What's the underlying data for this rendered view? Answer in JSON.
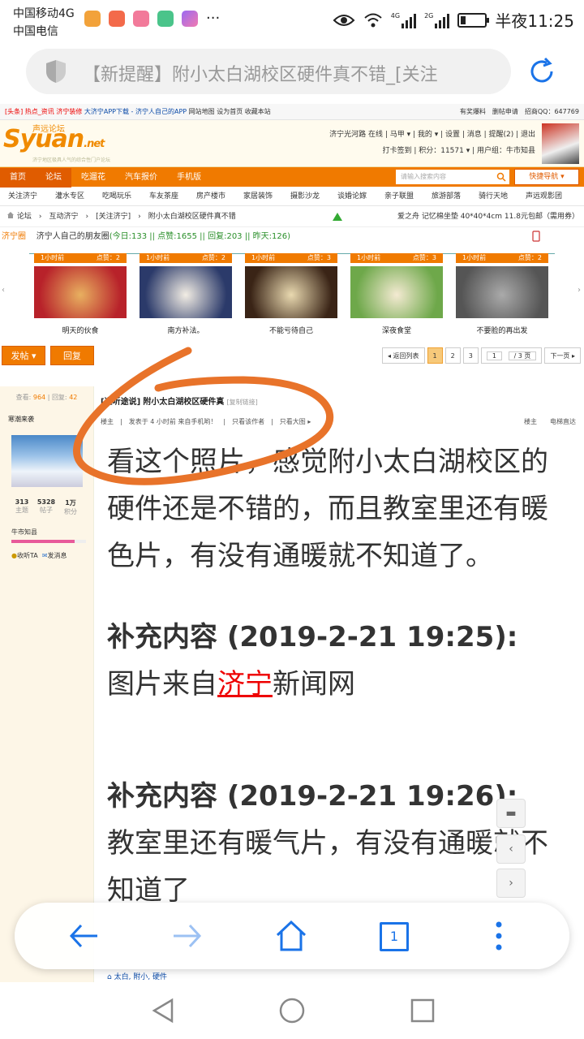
{
  "status": {
    "carrier1": "中国移动4G",
    "carrier2": "中国电信",
    "net1": "4G",
    "net2": "2G",
    "time": "半夜11:25"
  },
  "browser": {
    "url_title": "【新提醒】附小太白湖校区硬件真不错_[关注"
  },
  "site": {
    "topnav": {
      "hot": "[头条]",
      "hot_link": "热点_资讯",
      "jn": "济宁装修",
      "app": "大济宁APP下载 - 济宁人自己的APP",
      "map": "网站地图",
      "home": "设为首页",
      "fav": "收藏本站",
      "right": "有奖爆料　删帖申请　招商QQ：647769"
    },
    "logo": "Syuan",
    "logo_net": ".net",
    "logo_sub": "声远论坛",
    "logo_tag": "济宁地区极具人气的综合性门户论坛",
    "user": {
      "line1": "济宁光河路 在线 | 马甲 ▾ | 我的 ▾ | 设置 | 消息 | 提醒(2) | 退出",
      "line2": "打卡签到 | 积分：11571 ▾ | 用户组：牛市知县"
    },
    "mainnav": [
      "首页",
      "论坛",
      "吃遛花",
      "汽车报价",
      "手机版"
    ],
    "search_placeholder": "请输入搜索内容",
    "quicknav": "快捷导航 ▾",
    "subnav": [
      "关注济宁",
      "灌水专区",
      "吃喝玩乐",
      "车友茶座",
      "房产楼市",
      "家居装饰",
      "摄影沙龙",
      "谈婚论嫁",
      "亲子联盟",
      "旅游部落",
      "骑行天地",
      "声远观影团"
    ],
    "crumb": "论坛　›　互动济宁　›　[关注济宁]　›　附小太白湖校区硬件真不错",
    "crumb_ad": "爱之舟 记忆棉坐垫 40*40*4cm 11.8元包邮（需用券）",
    "circle": {
      "title": "济宁圈",
      "desc": "济宁人自己的朋友圈",
      "stats": "(今日:133 || 点赞:1655 || 回复:203 || 昨天:126)"
    },
    "pics": [
      {
        "time": "1小时前",
        "likes": "点赞：2",
        "caption": "明天的伙食",
        "color1": "#b8222a",
        "color2": "#e8b060"
      },
      {
        "time": "1小时前",
        "likes": "点赞：2",
        "caption": "南方补法。",
        "color1": "#2b3a6a",
        "color2": "#f2ede4"
      },
      {
        "time": "1小时前",
        "likes": "点赞：3",
        "caption": "不能亏待自己",
        "color1": "#3a2416",
        "color2": "#e9d9b0"
      },
      {
        "time": "1小时前",
        "likes": "点赞：3",
        "caption": "深夜食堂",
        "color1": "#6ea84a",
        "color2": "#f4ead2"
      },
      {
        "time": "1小时前",
        "likes": "点赞：2",
        "caption": "不要脸的再出发",
        "color1": "#555",
        "color2": "#aaa"
      }
    ],
    "buttons": {
      "post": "发帖 ▾",
      "reply": "回复"
    },
    "pager": {
      "back": "◂ 返回列表",
      "p1": "1",
      "p2": "2",
      "p3": "3",
      "input": "1",
      "total": "/ 3 页",
      "next": "下一页 ▸"
    }
  },
  "post": {
    "views_label": "查看:",
    "views": "964",
    "replies_label": "回复:",
    "replies": "42",
    "author": "寒潮来袭",
    "stats": [
      {
        "num": "313",
        "label": "主题"
      },
      {
        "num": "5328",
        "label": "帖子"
      },
      {
        "num": "1万",
        "label": "积分"
      }
    ],
    "level": "牛市知县",
    "level_fill": 0.85,
    "follow": "收听TA",
    "msg": "发消息",
    "title_prefix": "[道听途说]",
    "title": "附小太白湖校区硬件真",
    "title_copy": "[复制链接]",
    "meta": "楼主　|　发表于 4 小时前 来自手机哟！　|　只看该作者　|　只看大图 ▸",
    "meta_r": "楼主　　电梯直达",
    "para1": "看这个照片，感觉附小太白湖校区的硬件还是不错的，而且教室里还有暖色片，有没有通暖就不知道了。",
    "sup1": "补充内容 (2019-2-21 19:25):",
    "sup1_text_a": "图片来自",
    "sup1_link": "济宁",
    "sup1_text_b": "新闻网",
    "sup2": "补充内容 (2019-2-21 19:26):",
    "sup2_text": "教室里还有暖气片，有没有通暖就不知道了",
    "tags": "太白, 附小, 硬件"
  },
  "colors": {
    "orange": "#f07a00",
    "annotation": "#e8732a",
    "bottom_icon": "#1a73e8"
  },
  "bottombar": {
    "tabs": "1"
  }
}
